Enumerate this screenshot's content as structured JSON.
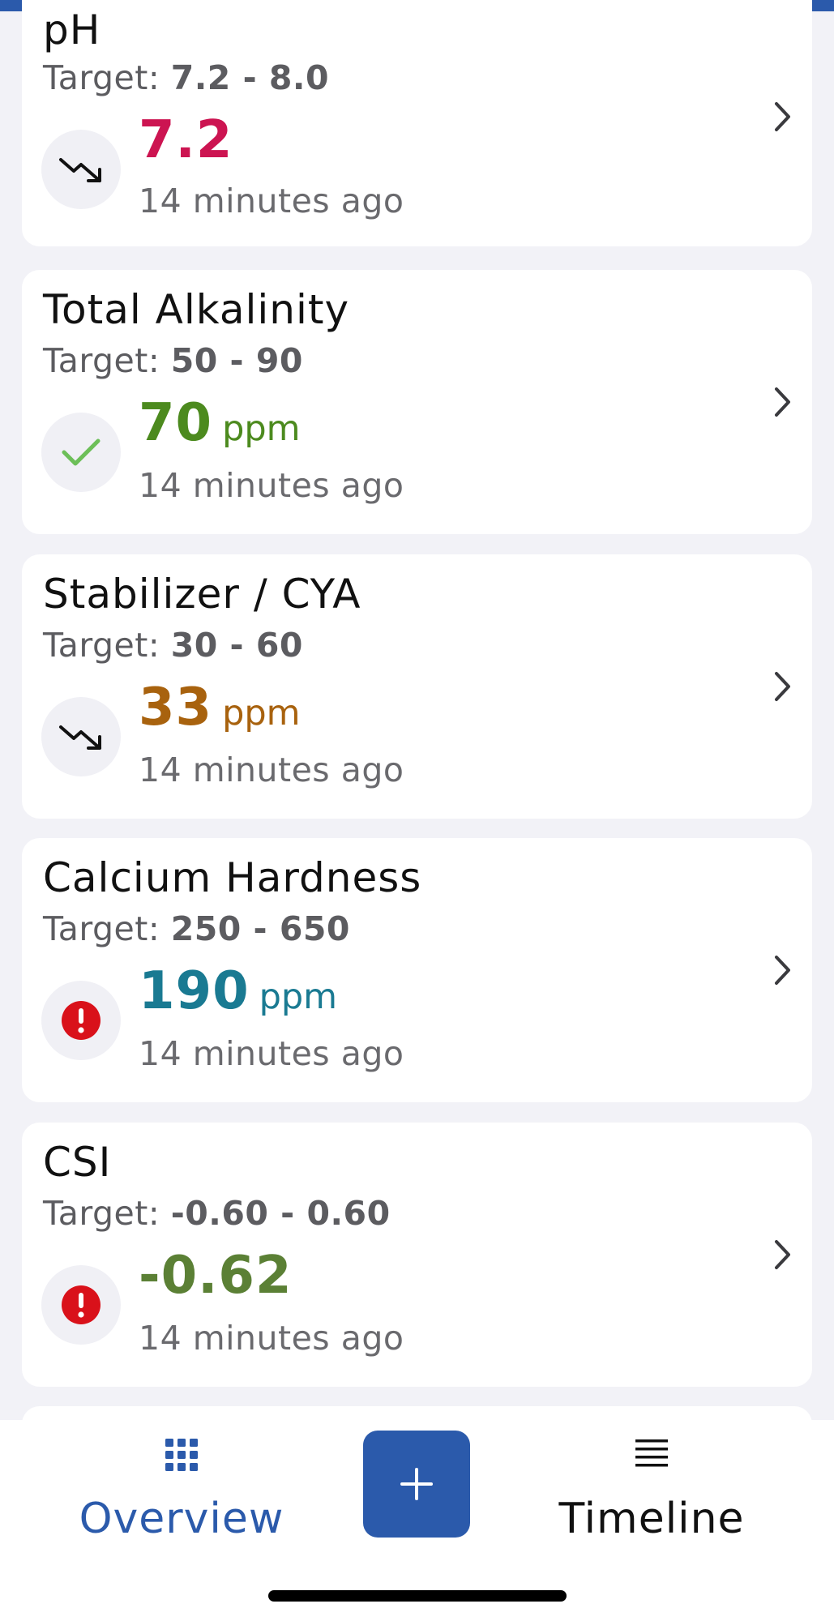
{
  "colors": {
    "accent": "#2b5aab",
    "ph_value": "#cc1451",
    "alkalinity_value": "#4c8a1e",
    "cya_value": "#a8620e",
    "calcium_value": "#1a7a92",
    "csi_value": "#5b8035",
    "alert_red": "#d9111a",
    "check_green": "#6cbf58"
  },
  "cards": [
    {
      "title": "pH",
      "target_prefix": "Target: ",
      "target_range": "7.2 - 8.0",
      "value": "7.2",
      "unit": "",
      "time": "14 minutes ago",
      "status_icon": "trend-down-icon"
    },
    {
      "title": "Total Alkalinity",
      "target_prefix": "Target: ",
      "target_range": "50 - 90",
      "value": "70",
      "unit": "ppm",
      "time": "14 minutes ago",
      "status_icon": "checkmark-icon"
    },
    {
      "title": "Stabilizer / CYA",
      "target_prefix": "Target: ",
      "target_range": "30 - 60",
      "value": "33",
      "unit": "ppm",
      "time": "14 minutes ago",
      "status_icon": "trend-down-icon"
    },
    {
      "title": "Calcium Hardness",
      "target_prefix": "Target: ",
      "target_range": "250 - 650",
      "value": "190",
      "unit": "ppm",
      "time": "14 minutes ago",
      "status_icon": "alert-icon"
    },
    {
      "title": "CSI",
      "target_prefix": "Target: ",
      "target_range": "-0.60 - 0.60",
      "value": "-0.62",
      "unit": "",
      "time": "14 minutes ago",
      "status_icon": "alert-icon"
    }
  ],
  "tabbar": {
    "overview_label": "Overview",
    "timeline_label": "Timeline",
    "add_icon": "plus-icon",
    "overview_icon": "grid-icon",
    "timeline_icon": "list-icon"
  }
}
